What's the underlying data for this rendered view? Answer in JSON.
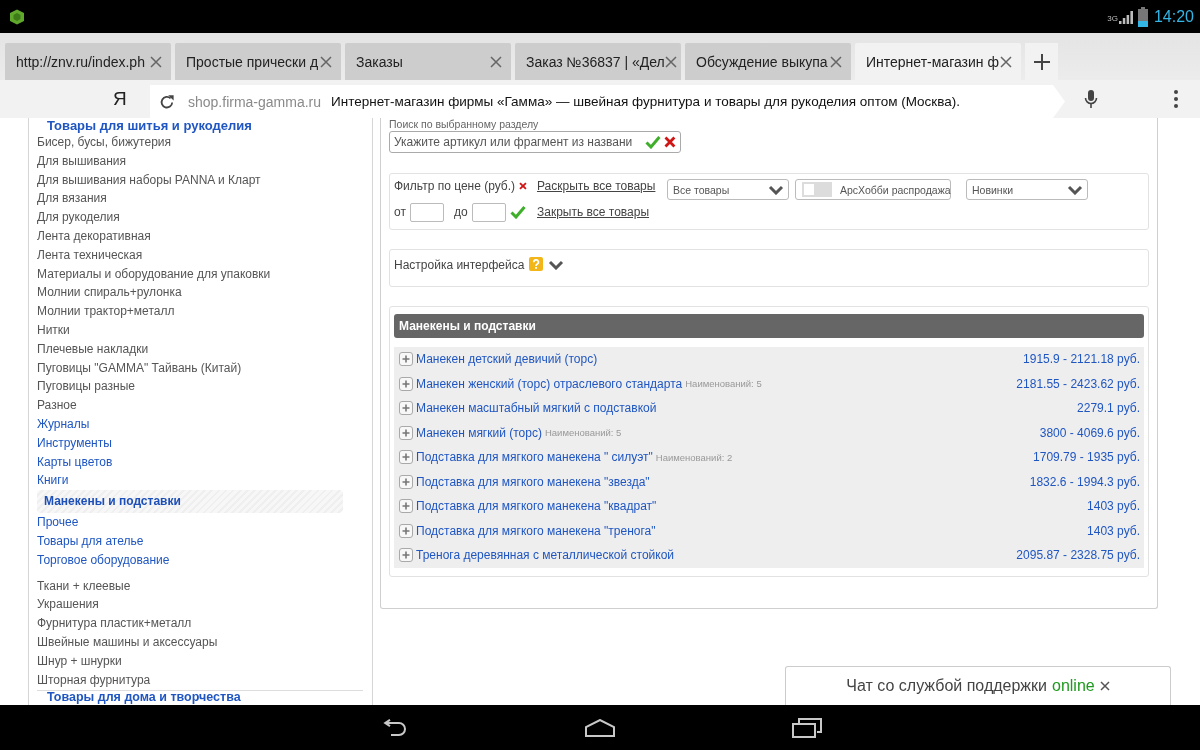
{
  "status_bar": {
    "network_type": "3G",
    "time": "14:20"
  },
  "tabs": [
    {
      "label": "http://znv.ru/index.ph",
      "selected": false
    },
    {
      "label": "Простые прически д",
      "selected": false
    },
    {
      "label": "Заказы",
      "selected": false
    },
    {
      "label": "Заказ №36837 | «Дел",
      "selected": false
    },
    {
      "label": "Обсуждение выкупа",
      "selected": false
    },
    {
      "label": "Интернет-магазин ф",
      "selected": true
    }
  ],
  "address_bar": {
    "search_engine": "Я",
    "domain": "shop.firma-gamma.ru",
    "page_title": "Интернет-магазин фирмы «Гамма» — швейная фурнитура и товары для рукоделия оптом (Москва)."
  },
  "sidebar": {
    "heading": "Товары для шитья и рукоделия",
    "items": [
      {
        "label": "Бисер, бусы, бижутерия",
        "selected": false
      },
      {
        "label": "Для вышивания",
        "selected": false
      },
      {
        "label": "Для вышивания наборы PANNA и Кларт",
        "selected": false
      },
      {
        "label": "Для вязания",
        "selected": false
      },
      {
        "label": "Для рукоделия",
        "selected": false
      },
      {
        "label": "Лента декоративная",
        "selected": false
      },
      {
        "label": "Лента техническая",
        "selected": false
      },
      {
        "label": "Материалы и оборудование для упаковки",
        "selected": false
      },
      {
        "label": "Молнии спираль+рулонка",
        "selected": false
      },
      {
        "label": "Молнии трактор+металл",
        "selected": false
      },
      {
        "label": "Нитки",
        "selected": false
      },
      {
        "label": "Плечевые накладки",
        "selected": false
      },
      {
        "label": "Пуговицы \"GAMMA\" Тайвань (Китай)",
        "selected": false
      },
      {
        "label": "Пуговицы разные",
        "selected": false
      },
      {
        "label": "Разное",
        "selected": false,
        "children": [
          {
            "label": "Журналы",
            "selected": false
          },
          {
            "label": "Инструменты",
            "selected": false
          },
          {
            "label": "Карты цветов",
            "selected": false
          },
          {
            "label": "Книги",
            "selected": false
          },
          {
            "label": "Манекены и подставки",
            "selected": true
          },
          {
            "label": "Прочее",
            "selected": false
          },
          {
            "label": "Товары для ателье",
            "selected": false
          },
          {
            "label": "Торговое оборудование",
            "selected": false
          }
        ]
      },
      {
        "label": "Ткани + клеевые",
        "selected": false
      },
      {
        "label": "Украшения",
        "selected": false
      },
      {
        "label": "Фурнитура пластик+металл",
        "selected": false
      },
      {
        "label": "Швейные машины и аксессуары",
        "selected": false
      },
      {
        "label": "Шнур + шнурки",
        "selected": false
      },
      {
        "label": "Шторная фурнитура",
        "selected": false
      }
    ],
    "footer_heading": "Товары для дома и творчества"
  },
  "search": {
    "label": "Поиск по выбранному разделу",
    "placeholder": "Укажите артикул или фрагмент из названи"
  },
  "filter": {
    "price_label": "Фильтр по цене (руб.)",
    "from_label": "от",
    "to_label": "до",
    "links": [
      "Раскрыть все товары",
      "Закрыть все товары"
    ],
    "category_select": "Все товары",
    "sale_toggle": {
      "label": "АрсХобби распродажа",
      "on": false
    },
    "sort_select": "Новинки"
  },
  "settings": {
    "label": "Настройка интерфейса",
    "expanded": false
  },
  "products": {
    "title": "Манекены и подставки",
    "rows": [
      {
        "name": "Манекен детский девичий (торс)",
        "price": "1915.9 - 2121.18 руб."
      },
      {
        "name": "Манекен женский (торс) отраслевого стандарта",
        "count": "Наименований: 5",
        "price": "2181.55 - 2423.62 руб."
      },
      {
        "name": "Манекен масштабный мягкий с подставкой",
        "price": "2279.1 руб."
      },
      {
        "name": "Манекен мягкий (торс)",
        "count": "Наименований: 5",
        "price": "3800 - 4069.6 руб."
      },
      {
        "name": "Подставка для мягкого манекена \" силуэт\"",
        "count": "Наименований: 2",
        "price": "1709.79 - 1935 руб."
      },
      {
        "name": "Подставка для мягкого манекена \"звезда\"",
        "price": "1832.6 - 1994.3 руб."
      },
      {
        "name": "Подставка для мягкого манекена \"квадрат\"",
        "price": "1403 руб."
      },
      {
        "name": "Подставка для мягкого манекена \"тренога\"",
        "price": "1403 руб."
      },
      {
        "name": "Тренога деревянная с металлической стойкой",
        "price": "2095.87 - 2328.75 руб."
      }
    ]
  },
  "chat": {
    "label": "Чат со службой поддержки",
    "status": "online"
  }
}
